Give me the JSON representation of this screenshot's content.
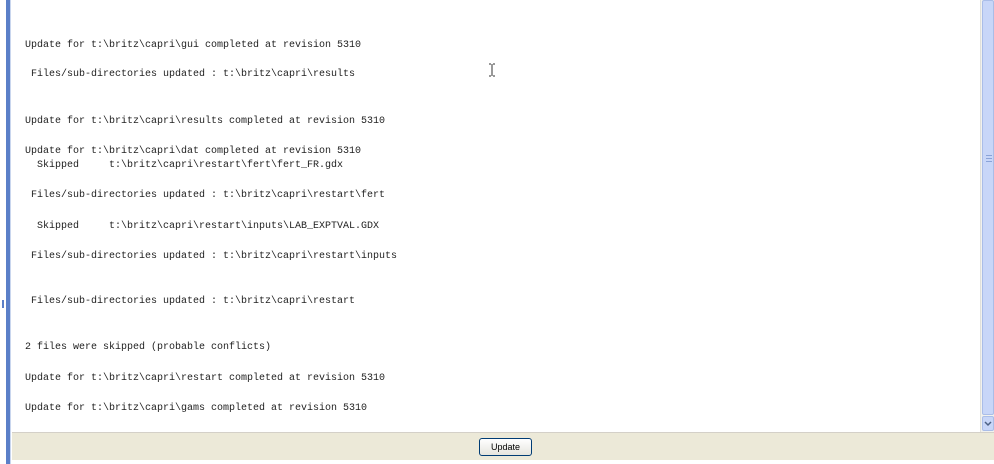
{
  "log": {
    "lines": [
      "Update for t:\\britz\\capri\\gui completed at revision 5310",
      " Files/sub-directories updated : t:\\britz\\capri\\results",
      "Update for t:\\britz\\capri\\results completed at revision 5310",
      "Update for t:\\britz\\capri\\dat completed at revision 5310",
      "  Skipped     t:\\britz\\capri\\restart\\fert\\fert_FR.gdx",
      " Files/sub-directories updated : t:\\britz\\capri\\restart\\fert",
      "  Skipped     t:\\britz\\capri\\restart\\inputs\\LAB_EXPTVAL.GDX",
      " Files/sub-directories updated : t:\\britz\\capri\\restart\\inputs",
      " Files/sub-directories updated : t:\\britz\\capri\\restart",
      "2 files were skipped (probable conflicts)",
      "Update for t:\\britz\\capri\\restart completed at revision 5310",
      "Update for t:\\britz\\capri\\gams completed at revision 5310"
    ]
  },
  "toolbar": {
    "update_label": "Update"
  },
  "icons": {
    "cursor": "text-cursor-icon",
    "scroll_down": "chevron-down-icon"
  }
}
